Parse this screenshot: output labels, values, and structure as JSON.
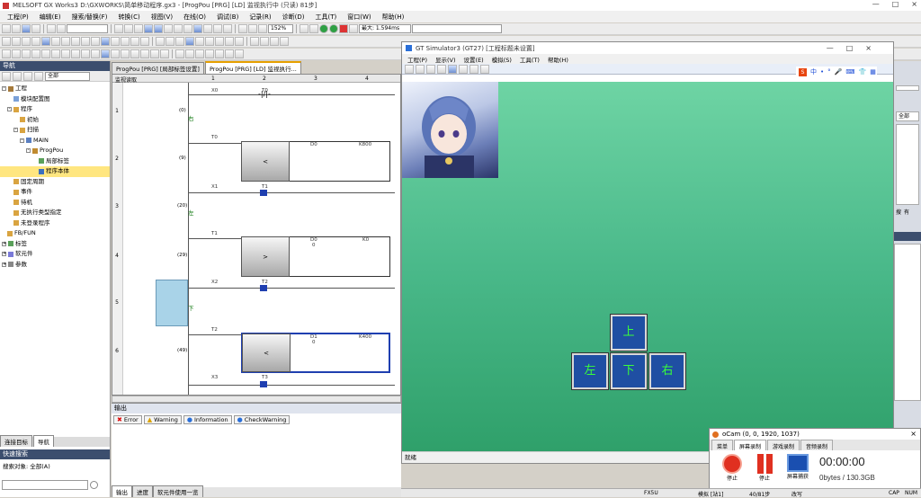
{
  "app": {
    "title": "MELSOFT GX Works3 D:\\GXWORKS\\简单移动程序.gx3 - [ProgPou [PRG] [LD] 监视执行中 (只读) 81步]",
    "window_controls": [
      "—",
      "□",
      "×"
    ]
  },
  "menu": [
    "工程(P)",
    "编辑(E)",
    "搜索/替换(F)",
    "转换(C)",
    "视图(V)",
    "在线(O)",
    "调试(B)",
    "记录(R)",
    "诊断(D)",
    "工具(T)",
    "窗口(W)",
    "帮助(H)"
  ],
  "toolbar": {
    "zoom": "152%",
    "scan_time": "最大: 1.594ms"
  },
  "navigation": {
    "title": "导航",
    "filter": "全部",
    "tree": [
      {
        "label": "工程",
        "level": 0
      },
      {
        "label": "模块配置图",
        "level": 1
      },
      {
        "label": "程序",
        "level": 1
      },
      {
        "label": "初始",
        "level": 2
      },
      {
        "label": "扫描",
        "level": 2
      },
      {
        "label": "MAIN",
        "level": 3
      },
      {
        "label": "ProgPou",
        "level": 4
      },
      {
        "label": "局部标签",
        "level": 5
      },
      {
        "label": "程序本体",
        "level": 5,
        "selected": true
      },
      {
        "label": "固定周期",
        "level": 2
      },
      {
        "label": "事件",
        "level": 2
      },
      {
        "label": "待机",
        "level": 2
      },
      {
        "label": "无执行类型指定",
        "level": 2
      },
      {
        "label": "未登录程序",
        "level": 2
      },
      {
        "label": "FB/FUN",
        "level": 1
      },
      {
        "label": "标签",
        "level": 0
      },
      {
        "label": "软元件",
        "level": 0
      },
      {
        "label": "参数",
        "level": 0
      }
    ],
    "bottom_tabs": [
      "连接目标",
      "导航"
    ],
    "quick_search_title": "快速搜索",
    "search_target": "搜索对象: 全部(A)"
  },
  "editor_tabs": [
    {
      "label": "ProgPou [PRG] [局部标签设置]",
      "active": false
    },
    {
      "label": "ProgPou [PRG] [LD] 监视执行...",
      "active": true
    }
  ],
  "ladder": {
    "header_label": "监视读取",
    "columns": [
      "1",
      "2",
      "3",
      "4"
    ],
    "rungs": [
      {
        "num": "1",
        "step": "(0)",
        "contact": "X0",
        "coil": "T0",
        "label": "右"
      },
      {
        "num": "2",
        "step": "(9)",
        "contact": "T0",
        "op": "<",
        "a": "D0",
        "b": "K800"
      },
      {
        "num": "3",
        "step": "(20)",
        "contact": "X1",
        "coil": "T1",
        "label": "左"
      },
      {
        "num": "4",
        "step": "(29)",
        "contact": "T1",
        "op": ">",
        "a": "D0",
        "a_val": "0",
        "b": "K0"
      },
      {
        "num": "5",
        "step": "",
        "contact": "X2",
        "coil": "T2",
        "label": "下"
      },
      {
        "num": "6",
        "step": "(49)",
        "contact": "T2",
        "op": "<",
        "a": "D1",
        "a_val": "0",
        "b": "K400"
      },
      {
        "num": "",
        "step": "",
        "contact": "X3",
        "coil": "T3"
      }
    ]
  },
  "output": {
    "title": "输出",
    "buttons": [
      "Error",
      "Warning",
      "Information",
      "CheckWarning"
    ],
    "bottom_tabs": [
      "输出",
      "进度",
      "软元件使用一览"
    ]
  },
  "gt_sim": {
    "title": "GT Simulator3 (GT27) [工程标题未设置]",
    "menu": [
      "工程(P)",
      "显示(V)",
      "设置(E)",
      "模拟(S)",
      "工具(T)",
      "帮助(H)"
    ],
    "buttons": {
      "up": "上",
      "left": "左",
      "down": "下",
      "right": "右"
    },
    "status": "就绪",
    "ime": [
      "中",
      "•",
      "°"
    ]
  },
  "ocam": {
    "title": "oCam (0, 0, 1920, 1037)",
    "tabs": [
      "菜单",
      "屏幕录制",
      "游戏录制",
      "音频录制"
    ],
    "buttons": [
      "停止",
      "停止",
      "屏幕捕获"
    ],
    "time": "00:00:00",
    "size": "0bytes / 130.3GB"
  },
  "right_panel": {
    "filter": "全部",
    "btn_a": "搜",
    "btn_b": "有"
  },
  "statusbar": {
    "items": [
      "FX5U",
      "模拟 [站1]",
      "40/81步",
      "改写",
      "CAP",
      "NUM"
    ]
  },
  "colors": {
    "nav_header": "#3c4e6e",
    "gt_green": "#4ab98a",
    "dpad_blue": "#1f4fa3",
    "dpad_text": "#39ff39",
    "tree_selected": "#ffe680"
  }
}
